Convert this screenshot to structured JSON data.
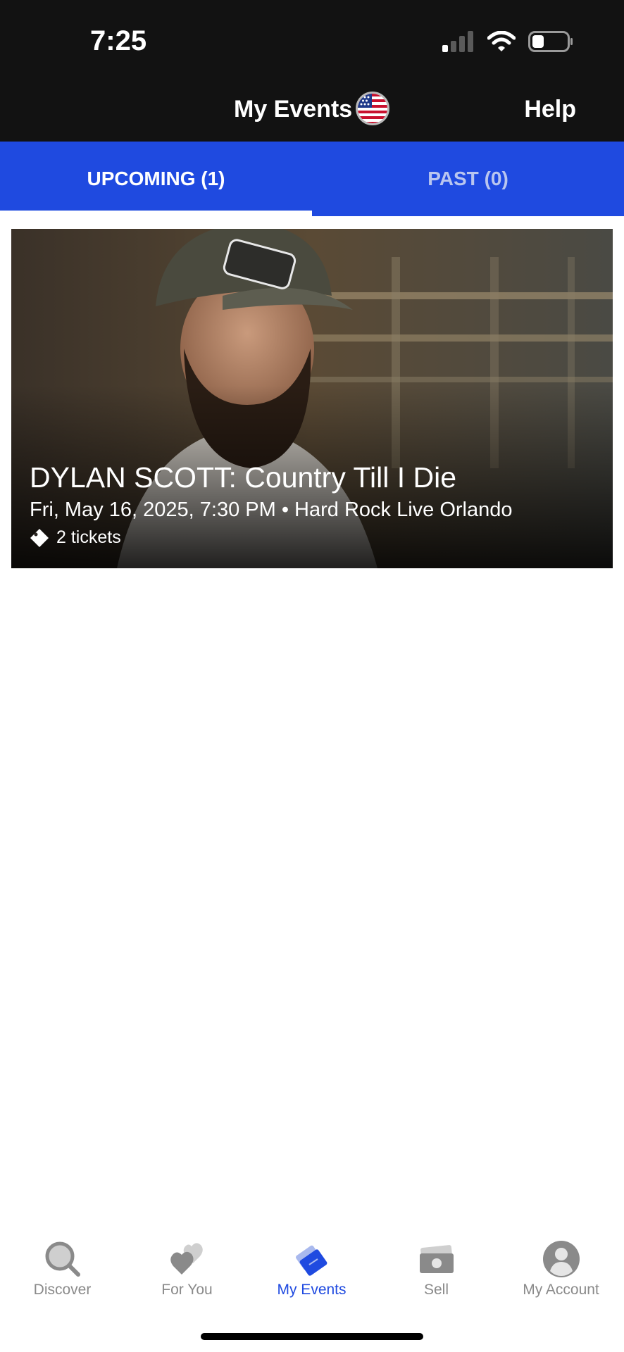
{
  "status_bar": {
    "time": "7:25",
    "icons": [
      "cellular-signal-icon",
      "wifi-icon",
      "battery-icon"
    ]
  },
  "header": {
    "title": "My Events",
    "region_icon": "us-flag-icon",
    "help_label": "Help"
  },
  "tabs": [
    {
      "label": "UPCOMING (1)",
      "active": true
    },
    {
      "label": "PAST (0)",
      "active": false
    }
  ],
  "events": [
    {
      "title": "DYLAN SCOTT:  Country Till I Die",
      "meta": "Fri, May 16, 2025, 7:30 PM • Hard Rock Live Orlando",
      "tickets": "2 tickets",
      "ticket_icon": "ticket-icon"
    }
  ],
  "bottom_nav": [
    {
      "label": "Discover",
      "icon": "search-icon",
      "active": false
    },
    {
      "label": "For You",
      "icon": "hearts-icon",
      "active": false
    },
    {
      "label": "My Events",
      "icon": "tickets-icon",
      "active": true
    },
    {
      "label": "Sell",
      "icon": "cash-icon",
      "active": false
    },
    {
      "label": "My Account",
      "icon": "account-icon",
      "active": false
    }
  ],
  "colors": {
    "accent": "#1f4ae0",
    "header_bg": "#121212",
    "nav_inactive": "#8a8a8a"
  }
}
